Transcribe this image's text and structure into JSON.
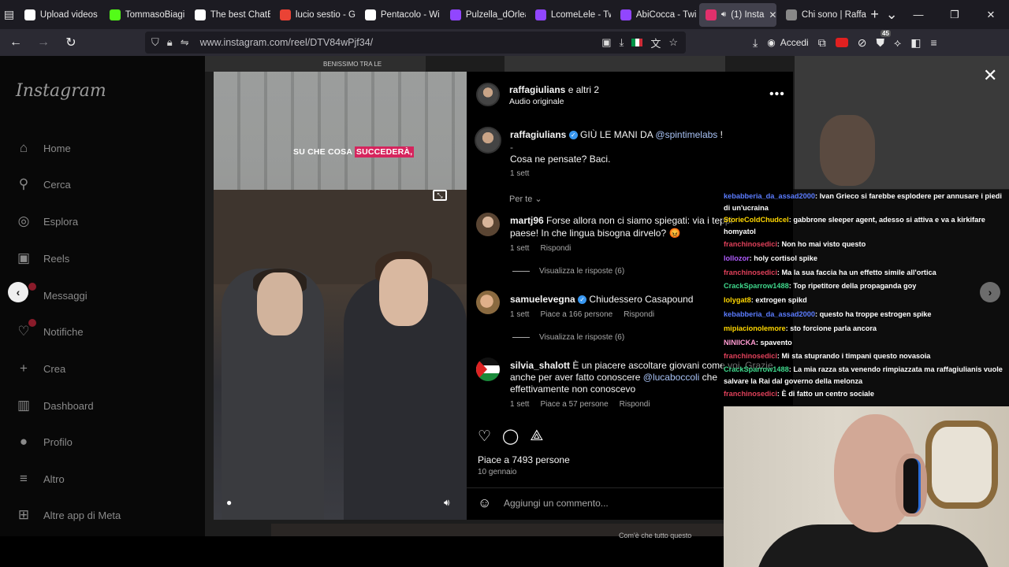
{
  "browser": {
    "tabs": [
      {
        "label": "Upload videos",
        "icon": "youtube-studio-icon",
        "color": "#ffffff"
      },
      {
        "label": "TommasoBiagi",
        "icon": "kick-icon",
        "color": "#53fc18"
      },
      {
        "label": "The best ChatB",
        "icon": "chatbot-icon",
        "color": "#ffffff"
      },
      {
        "label": "lucio sestio - G",
        "icon": "google-icon",
        "color": "#ea4335"
      },
      {
        "label": "Pentacolo - Wi",
        "icon": "wikipedia-icon",
        "color": "#ffffff"
      },
      {
        "label": "Pulzella_dOrlea",
        "icon": "twitch-icon",
        "color": "#9146ff"
      },
      {
        "label": "LcomeLele - Tw",
        "icon": "twitch-icon",
        "color": "#9146ff"
      },
      {
        "label": "AbiCocca - Twi",
        "icon": "twitch-icon",
        "color": "#9146ff"
      },
      {
        "label": "(1) Insta",
        "icon": "instagram-icon",
        "color": "#e1306c",
        "active": true
      },
      {
        "label": "Chi sono | Raffa",
        "icon": "page-icon",
        "color": "#888888"
      }
    ],
    "url": "www.instagram.com/reel/DTV84wPjf34/",
    "accedi_label": "Accedi",
    "ext_badge": "45"
  },
  "instagram": {
    "logo": "Instagram",
    "nav": [
      {
        "label": "Home",
        "icon": "home-icon",
        "glyph": "⌂"
      },
      {
        "label": "Cerca",
        "icon": "search-icon",
        "glyph": "⚲"
      },
      {
        "label": "Esplora",
        "icon": "compass-icon",
        "glyph": "◎"
      },
      {
        "label": "Reels",
        "icon": "reels-icon",
        "glyph": "▣"
      },
      {
        "label": "Messaggi",
        "icon": "messenger-icon",
        "glyph": "✈"
      },
      {
        "label": "Notifiche",
        "icon": "heart-icon",
        "glyph": "♡"
      },
      {
        "label": "Crea",
        "icon": "plus-icon",
        "glyph": "+"
      },
      {
        "label": "Dashboard",
        "icon": "dashboard-icon",
        "glyph": "▥"
      },
      {
        "label": "Profilo",
        "icon": "profile-icon",
        "glyph": "●"
      },
      {
        "label": "Altro",
        "icon": "menu-icon",
        "glyph": "≡"
      },
      {
        "label": "Altre app di Meta",
        "icon": "meta-apps-icon",
        "glyph": "⊞"
      }
    ],
    "messages_badge": "1"
  },
  "reel": {
    "caption_text": "SU CHE COSA ",
    "caption_highlight": "SUCCEDERÀ,",
    "overlay_top": "BENISSIMO TRA LE",
    "bottom_overlay": "Com'è che tutto questo"
  },
  "post": {
    "author": "raffagiulians",
    "coauthors": " e altri 2",
    "audio": "Audio originale",
    "caption": {
      "user": "raffagiulians",
      "text": " GIÙ LE MANI DA ",
      "mention": "@spintimelabs",
      "end": " !",
      "dash": "-",
      "line2": "Cosa ne pensate? Baci.",
      "time": "1 sett"
    },
    "per_te": "Per te",
    "comments": [
      {
        "user": "martj96",
        "text": " Forse allora non ci siamo spiegati: via i teppi",
        "text2": "paese! In che lingua bisogna dirvelo? 😡",
        "time": "1 sett",
        "likes": "",
        "reply": "Rispondi",
        "view_replies": "Visualizza le risposte (6)"
      },
      {
        "user": "samuelevegna",
        "text": " Chiudessero Casapound",
        "time": "1 sett",
        "likes": "Piace a 166 persone",
        "reply": "Rispondi",
        "view_replies": "Visualizza le risposte (6)"
      },
      {
        "user": "silvia_shalott",
        "text": " È un piacere ascoltare giovani come voi. Grazie",
        "text2": "anche per aver fatto conoscere ",
        "mention": "@lucaboccoli",
        "text3": " che",
        "text4": "effettivamente non conoscevo",
        "time": "1 sett",
        "likes": "Piace a 57 persone",
        "reply": "Rispondi"
      }
    ],
    "likes": "Piace a 7493 persone",
    "date": "10 gennaio",
    "add_comment_placeholder": "Aggiungi un commento..."
  },
  "chat": [
    {
      "user": "kebabberia_da_assad2000",
      "color": "#5b7cff",
      "msg": ": Ivan Grieco si farebbe esplodere per annusare i piedi di un'ucraina"
    },
    {
      "user": "StorieColdChudcel",
      "color": "#ffd700",
      "msg": ": gabbrone sleeper agent, adesso si attiva e va a kirkifare homyatol"
    },
    {
      "user": "franchinosedici",
      "color": "#e0405a",
      "msg": ": Non ho mai visto questo"
    },
    {
      "user": "lollozor",
      "color": "#b05cff",
      "msg": ": holy cortisol spike"
    },
    {
      "user": "franchinosedici",
      "color": "#e0405a",
      "msg": ": Ma la sua faccia ha un effetto simile all'ortica"
    },
    {
      "user": "CrackSparrow1488",
      "color": "#3fd88c",
      "msg": ": Top ripetitore della propaganda goy"
    },
    {
      "user": "lolygat8",
      "color": "#ffd700",
      "msg": ": extrogen spikd"
    },
    {
      "user": "kebabberia_da_assad2000",
      "color": "#5b7cff",
      "msg": ": questo ha troppe estrogen spike"
    },
    {
      "user": "mipiacionolemore",
      "color": "#ffd700",
      "msg": ": sto forcione parla ancora"
    },
    {
      "user": "NINIICKA",
      "color": "#ff9ad1",
      "msg": ": spavento"
    },
    {
      "user": "franchinosedici",
      "color": "#e0405a",
      "msg": ": Mi sta stuprando i timpani questo novasoia"
    },
    {
      "user": "CrackSparrow1488",
      "color": "#3fd88c",
      "msg": ": La mia razza sta venendo rimpiazzata ma raffagiulianis vuole salvare la Rai dal governo della melonza"
    },
    {
      "user": "franchinosedici",
      "color": "#e0405a",
      "msg": ": È di fatto un centro sociale"
    }
  ]
}
